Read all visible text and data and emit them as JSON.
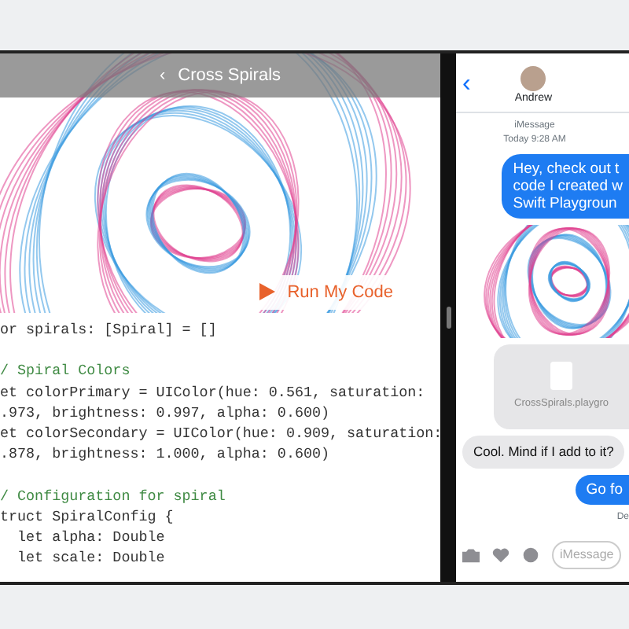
{
  "playground": {
    "title": "Cross Spirals",
    "back": "‹",
    "run_button": "Run My Code",
    "code_lines": [
      {
        "kind": "code",
        "text": "or spirals: [Spiral] = []"
      },
      {
        "kind": "blank"
      },
      {
        "kind": "comment",
        "text": "/ Spiral Colors"
      },
      {
        "kind": "code",
        "text": "et colorPrimary = UIColor(hue: 0.561, saturation:"
      },
      {
        "kind": "code",
        "text": ".973, brightness: 0.997, alpha: 0.600)"
      },
      {
        "kind": "code",
        "text": "et colorSecondary = UIColor(hue: 0.909, saturation:"
      },
      {
        "kind": "code",
        "text": ".878, brightness: 1.000, alpha: 0.600)"
      },
      {
        "kind": "blank"
      },
      {
        "kind": "comment",
        "text": "/ Configuration for spiral"
      },
      {
        "kind": "code",
        "text": "truct SpiralConfig {"
      },
      {
        "kind": "code",
        "text": "  let alpha: Double"
      },
      {
        "kind": "code",
        "text": "  let scale: Double"
      }
    ]
  },
  "messages": {
    "back": "‹",
    "contact": "Andrew",
    "service": "iMessage",
    "timestamp": "Today 9:28 AM",
    "items": [
      {
        "kind": "sent",
        "lines": [
          "Hey, check out t",
          "code I created w",
          "Swift Playgroun"
        ]
      },
      {
        "kind": "image"
      },
      {
        "kind": "file",
        "text": "CrossSpirals.playgro"
      },
      {
        "kind": "received",
        "lines": [
          "Cool. Mind if I add to it?"
        ]
      },
      {
        "kind": "sent",
        "lines": [
          "Go fo"
        ]
      },
      {
        "kind": "status",
        "text": "De"
      }
    ],
    "input": {
      "placeholder": "iMessage"
    }
  }
}
